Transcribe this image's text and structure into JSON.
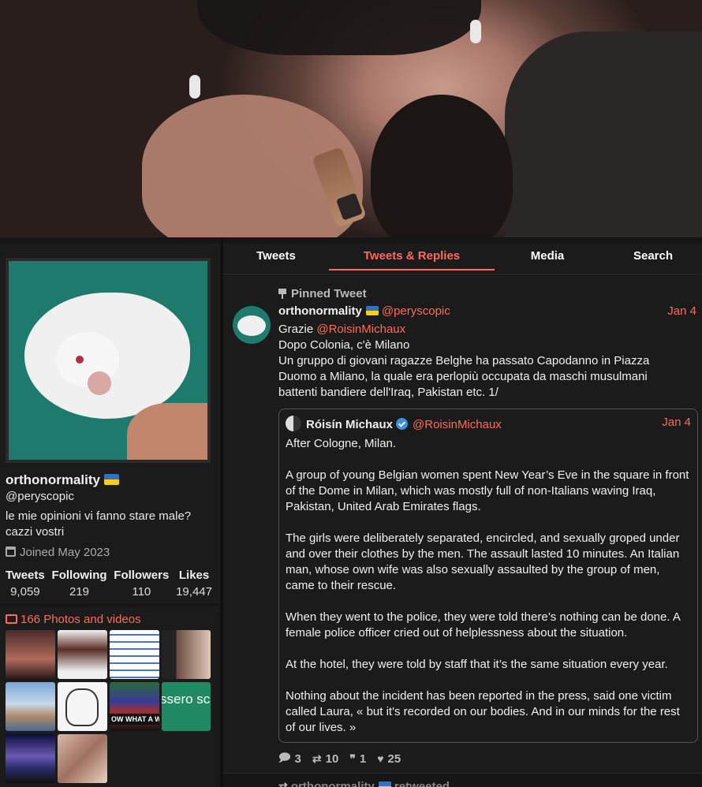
{
  "profile": {
    "name": "orthonormality",
    "handle": "@peryscopic",
    "bio": "le mie opinioni vi fanno stare male? cazzi vostri",
    "joined": "Joined May 2023",
    "stats": [
      {
        "label": "Tweets",
        "value": "9,059"
      },
      {
        "label": "Following",
        "value": "219"
      },
      {
        "label": "Followers",
        "value": "110"
      },
      {
        "label": "Likes",
        "value": "19,447"
      }
    ],
    "photos_label": "166 Photos and videos",
    "thumb_texts": {
      "t7": "OW WHAT A WO",
      "t8": "ssero sc"
    }
  },
  "tabs": [
    {
      "label": "Tweets",
      "active": false
    },
    {
      "label": "Tweets & Replies",
      "active": true
    },
    {
      "label": "Media",
      "active": false
    },
    {
      "label": "Search",
      "active": false
    }
  ],
  "tweet": {
    "pinned_label": "Pinned Tweet",
    "author_name": "orthonormality",
    "author_handle": "@peryscopic",
    "date": "Jan 4",
    "text_prefix": "Grazie ",
    "text_mention": "@RoisinMichaux",
    "text_line2": "Dopo Colonia, c'è Milano",
    "text_line3": "Un gruppo di giovani ragazze Belghe ha passato Capodanno in Piazza Duomo a Milano, la quale era perlopiù occupata da maschi musulmani battenti bandiere dell'Iraq, Pakistan etc. 1/",
    "quote": {
      "author_name": "Róisín Michaux",
      "author_handle": "@RoisinMichaux",
      "date": "Jan 4",
      "paragraphs": [
        "After Cologne, Milan.",
        "A group of young Belgian women spent New Year’s Eve in the square in front of the Dome in Milan, which was mostly full of non-Italians waving Iraq, Pakistan, United Arab Emirates flags.",
        "The girls were deliberately separated, encircled, and sexually groped under and over their clothes by the men. The assault lasted 10 minutes. An Italian man, whose own wife was also sexually assaulted by the group of men, came to their rescue.",
        "When they went to the police, they were told there’s nothing can be done. A female police officer cried out of helplessness about the situation.",
        "At the hotel, they were told by staff that it’s the same situation every year.",
        "Nothing about the incident has been reported in the press, said one victim called Laura, « but it's recorded on our bodies. And in our minds for the rest of our lives. »"
      ]
    },
    "stats": {
      "replies": "3",
      "retweets": "10",
      "quotes": "1",
      "likes": "25"
    }
  },
  "next_tweet": {
    "name": "orthonormality",
    "label": "retweeted"
  },
  "icons": {
    "reply": "comment-icon",
    "retweet": "retweet-icon",
    "quote": "quote-icon",
    "like": "heart-icon"
  },
  "colors": {
    "accent": "#ff6a5c",
    "background": "#0f0f0f",
    "panel": "#1b1b1b"
  }
}
